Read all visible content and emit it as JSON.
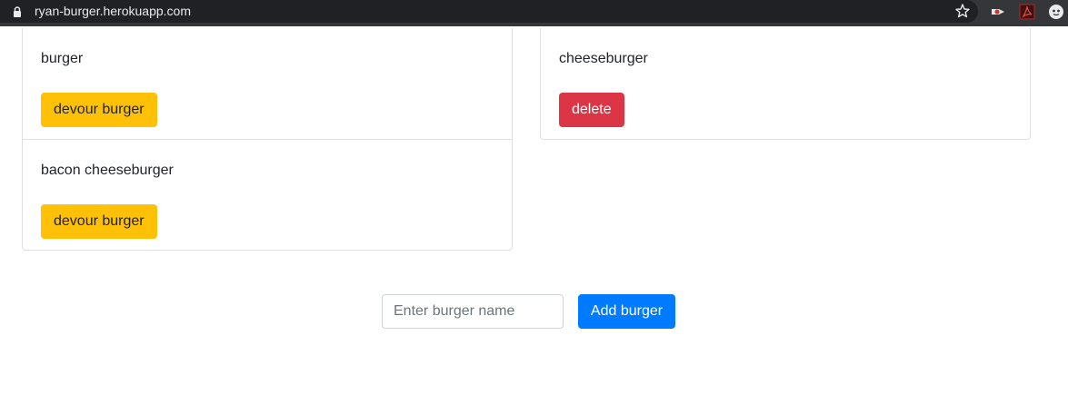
{
  "browser": {
    "url": "ryan-burger.herokuapp.com"
  },
  "burgers_left": [
    {
      "name": "burger",
      "action_label": "devour burger"
    },
    {
      "name": "bacon cheeseburger",
      "action_label": "devour burger"
    }
  ],
  "burgers_right": [
    {
      "name": "cheeseburger",
      "action_label": "delete"
    }
  ],
  "form": {
    "input_value": "",
    "input_placeholder": "Enter burger name",
    "submit_label": "Add burger"
  },
  "colors": {
    "warning": "#ffc107",
    "danger": "#dc3545",
    "primary": "#007bff",
    "browser_bar": "#35363a"
  }
}
